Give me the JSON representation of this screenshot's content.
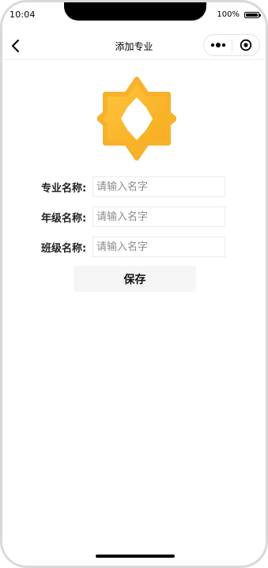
{
  "status_bar": {
    "time": "10:04",
    "battery_text": "100%",
    "battery_level": 1.0
  },
  "nav": {
    "title": "添加专业",
    "back_icon": "chevron-left-icon",
    "more_icon": "more-dots-icon",
    "close_icon": "target-circle-icon"
  },
  "logo": {
    "icon": "hexagram-star-logo",
    "color": "#FBB92B"
  },
  "form": {
    "fields": [
      {
        "label": "专业名称:",
        "placeholder": "请输入名字",
        "value": ""
      },
      {
        "label": "年级名称:",
        "placeholder": "请输入名字",
        "value": ""
      },
      {
        "label": "班级名称:",
        "placeholder": "请输入名字",
        "value": ""
      }
    ],
    "save_label": "保存"
  },
  "colors": {
    "accent": "#FBB92B",
    "button_bg": "#F5F5F5",
    "input_border": "#ECECEC"
  }
}
